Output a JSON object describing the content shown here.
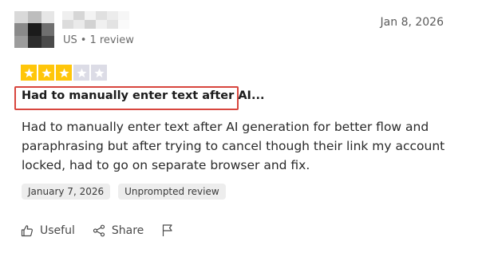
{
  "review": {
    "reviewer": {
      "country": "US",
      "separator": "•",
      "review_count": "1 review"
    },
    "date_posted": "Jan 8, 2026",
    "rating": {
      "value": 3,
      "max": 5,
      "filled_color": "#ffc60a",
      "empty_color": "#dcdce6"
    },
    "title": "Had to manually enter text after AI...",
    "body": "Had to manually enter text after AI generation for better flow and paraphrasing but after trying to cancel though their link my account locked, had to go on separate browser and fix.",
    "tags": [
      "January 7, 2026",
      "Unprompted review"
    ],
    "highlight_color": "#d8463e"
  },
  "actions": {
    "useful_label": "Useful",
    "share_label": "Share",
    "useful_icon": "thumbs-up-icon",
    "share_icon": "share-icon",
    "report_icon": "flag-icon"
  }
}
